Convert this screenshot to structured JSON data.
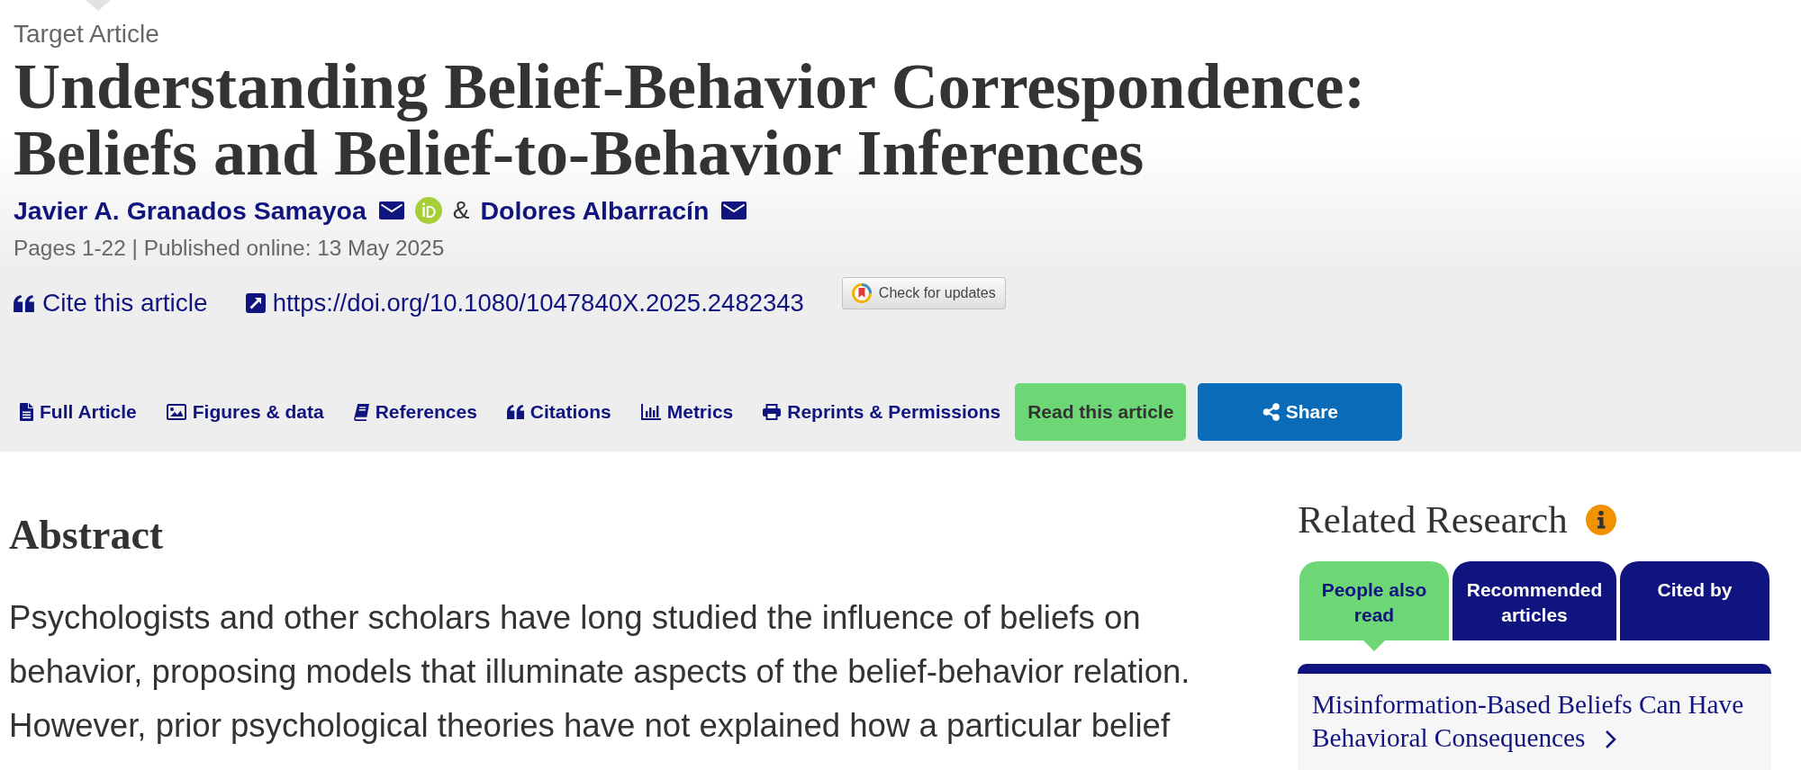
{
  "header": {
    "kicker": "Target Article",
    "title": "Understanding Belief-Behavior Correspondence: Beliefs and Belief-to-Behavior Inferences",
    "authors": [
      {
        "name": "Javier A. Granados Samayoa",
        "email": true,
        "orcid": true
      },
      {
        "name": "Dolores Albarracín",
        "email": true,
        "orcid": false
      }
    ],
    "author_separator": "&",
    "meta": "Pages 1-22 | Published online: 13 May 2025",
    "cite": "Cite this article",
    "doi": "https://doi.org/10.1080/1047840X.2025.2482343",
    "check_updates": "Check for updates"
  },
  "toolbar": {
    "links": [
      "Full Article",
      "Figures & data",
      "References",
      "Citations",
      "Metrics",
      "Reprints & Permissions"
    ],
    "read_button": "Read this article",
    "share_button": "Share"
  },
  "abstract": {
    "heading": "Abstract",
    "text": "Psychologists and other scholars have long studied the influence of beliefs on behavior, proposing models that illuminate aspects of the belief-behavior relation. However, prior psychological theories have not explained how a particular belief"
  },
  "related": {
    "heading": "Related Research",
    "tabs": [
      {
        "label": "People also read",
        "selected": true
      },
      {
        "label": "Recommended articles",
        "selected": false
      },
      {
        "label": "Cited by",
        "selected": false
      }
    ],
    "articles": [
      {
        "title": "Misinformation-Based Beliefs Can Have Behavioral Consequences"
      }
    ]
  }
}
